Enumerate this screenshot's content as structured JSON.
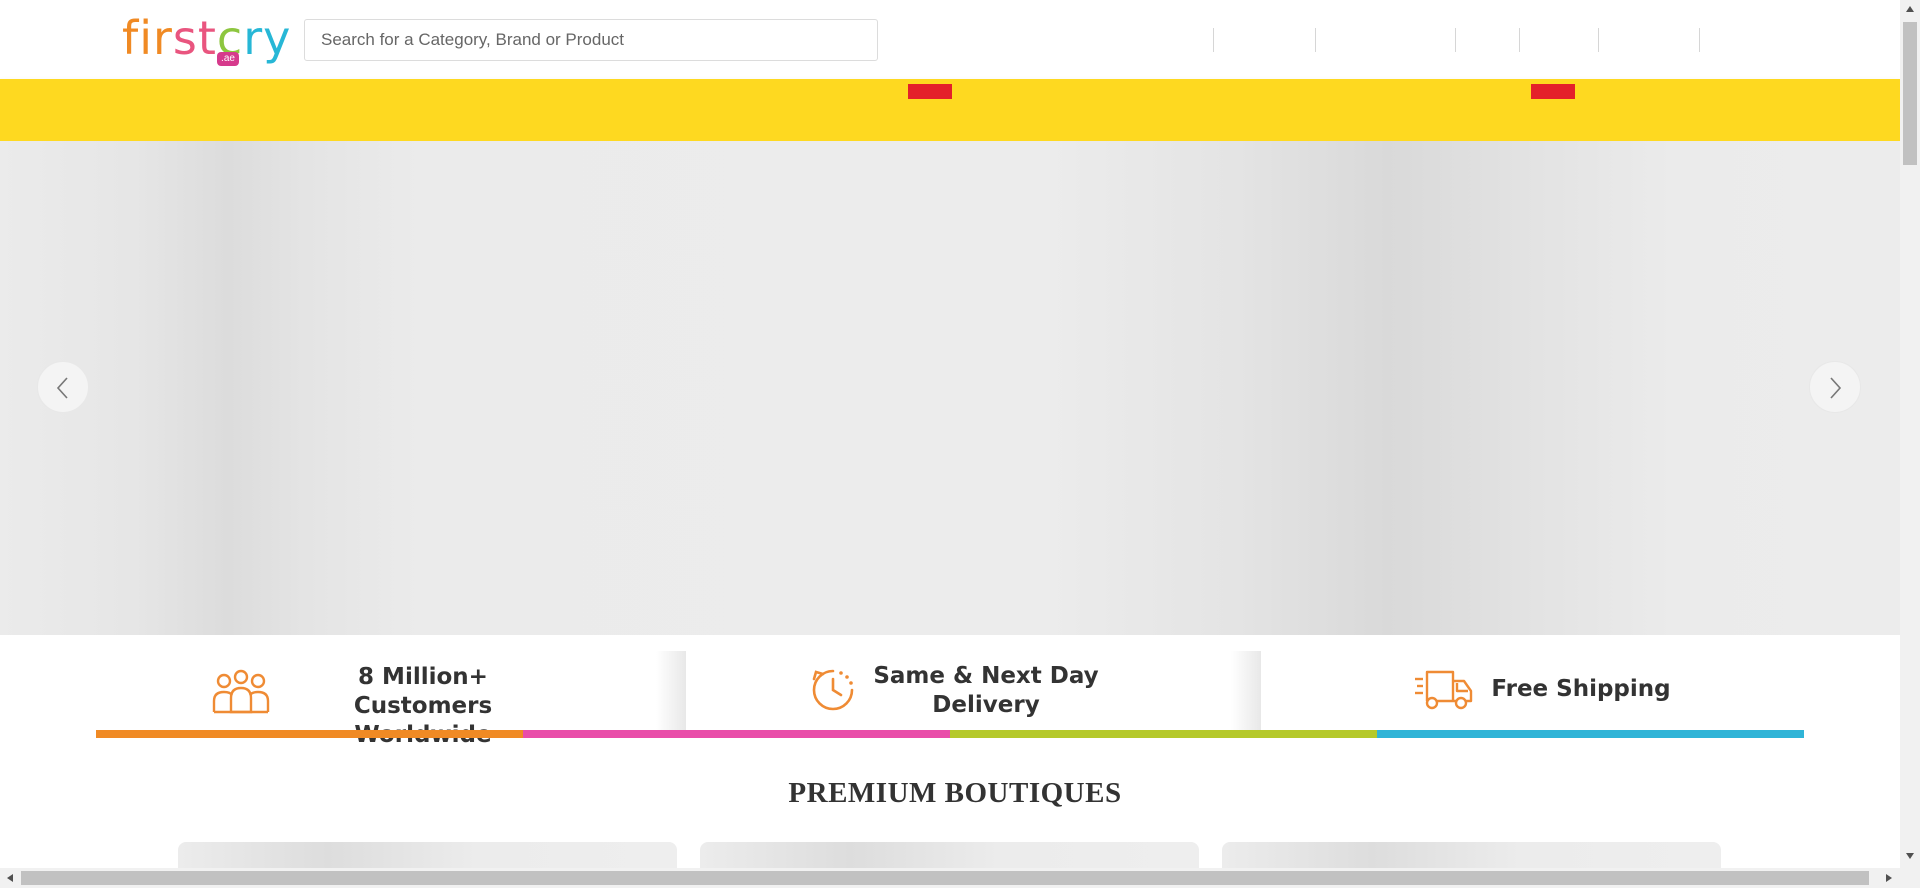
{
  "header": {
    "logo_text": "firstcry",
    "logo_tld": ".ae",
    "search_placeholder": "Search for a Category, Brand or Product"
  },
  "colors": {
    "nav_background": "#fed920",
    "badge_red": "#e4202a",
    "stripe_orange": "#f08a24",
    "stripe_pink": "#e94da9",
    "stripe_green": "#b5c92a",
    "stripe_blue": "#30b4d7",
    "icon_orange": "#ef8b34"
  },
  "hero": {
    "prev_icon": "chevron-left-icon",
    "next_icon": "chevron-right-icon"
  },
  "features": [
    {
      "icon": "customers-icon",
      "text_line1": "8 Million+ Customers",
      "text_line2": "Worldwide"
    },
    {
      "icon": "clock-icon",
      "text_line1": "Same & Next Day",
      "text_line2": "Delivery"
    },
    {
      "icon": "truck-icon",
      "text_line1": "Free Shipping",
      "text_line2": ""
    }
  ],
  "sections": {
    "premium_boutiques_title": "PREMIUM BOUTIQUES"
  }
}
